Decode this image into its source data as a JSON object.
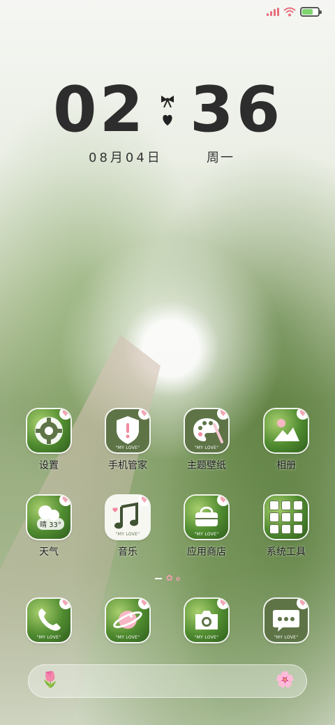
{
  "status_bar": {
    "signal_icon": "signal-bars-icon",
    "wifi_icon": "wifi-icon",
    "battery_icon": "battery-charging-icon",
    "battery_level": 0.64,
    "colors": {
      "signal": "#e86f7d",
      "wifi": "#e86f7d",
      "battery_fill": "#7fd46f"
    }
  },
  "clock": {
    "hours": "02",
    "minutes": "36",
    "separator_icons": [
      "bow-icon",
      "heart-icon"
    ],
    "date": "08月04日",
    "weekday": "周一"
  },
  "apps": [
    {
      "label": "设置",
      "icon": "gear-icon",
      "style": "photo"
    },
    {
      "label": "手机管家",
      "icon": "shield-icon",
      "style": "olive",
      "badge_text": "\"MY LOVE\""
    },
    {
      "label": "主题壁纸",
      "icon": "palette-icon",
      "style": "olive",
      "badge_text": "\"MY LOVE\""
    },
    {
      "label": "相册",
      "icon": "mountain-photo-icon",
      "style": "photo"
    },
    {
      "label": "天气",
      "icon": "weather-cloud-icon",
      "style": "photo",
      "weather_text": "晴 33°"
    },
    {
      "label": "音乐",
      "icon": "music-note-icon",
      "style": "white",
      "badge_text": "\"MY LOVE\""
    },
    {
      "label": "应用商店",
      "icon": "shopping-bag-icon",
      "style": "photo",
      "badge_text": "\"MY LOVE\""
    },
    {
      "label": "系统工具",
      "icon": "folder-icon",
      "style": "photo"
    }
  ],
  "dock": [
    {
      "name": "phone",
      "icon": "phone-icon",
      "badge_text": "\"MY LOVE\""
    },
    {
      "name": "browser",
      "icon": "planet-icon",
      "badge_text": "\"MY LOVE\""
    },
    {
      "name": "camera",
      "icon": "camera-icon",
      "badge_text": "\"MY LOVE\""
    },
    {
      "name": "messages",
      "icon": "chat-bubble-icon",
      "badge_text": "\"MY LOVE\""
    }
  ],
  "pager": {
    "icon": "flower-page-dot-icon"
  },
  "search": {
    "left_icon": "tulip-icon",
    "right_icon": "pink-flower-icon"
  },
  "theme_colors": {
    "olive": "#5e7447",
    "pink": "#f2a6b5"
  }
}
